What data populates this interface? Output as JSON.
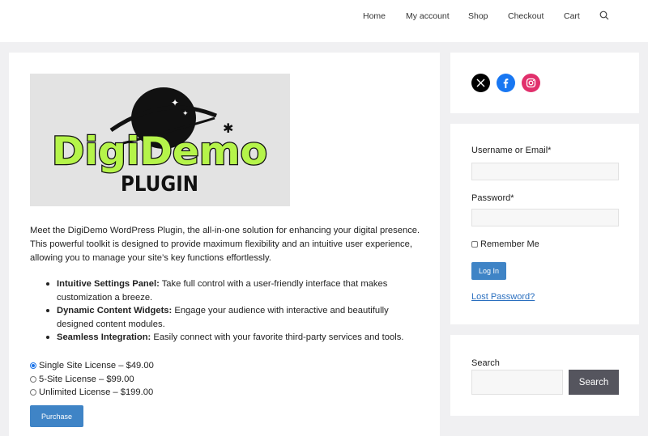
{
  "nav": {
    "items": [
      "Home",
      "My account",
      "Shop",
      "Checkout",
      "Cart"
    ],
    "search_icon": "search-icon"
  },
  "product": {
    "logo": {
      "line1": "DigiDemo",
      "line2": "PLUGIN"
    },
    "intro": "Meet the DigiDemo WordPress Plugin, the all-in-one solution for enhancing your digital presence. This powerful toolkit is designed to provide maximum flexibility and an intuitive user experience, allowing you to manage your site’s key functions effortlessly.",
    "features": [
      {
        "title": "Intuitive Settings Panel:",
        "text": "Take full control with a user-friendly interface that makes customization a breeze."
      },
      {
        "title": "Dynamic Content Widgets:",
        "text": "Engage your audience with interactive and beautifully designed content modules."
      },
      {
        "title": "Seamless Integration:",
        "text": "Easily connect with your favorite third-party services and tools."
      }
    ],
    "licenses": [
      {
        "label": "Single Site License – $49.00",
        "selected": true
      },
      {
        "label": "5-Site License – $99.00",
        "selected": false
      },
      {
        "label": "Unlimited License – $199.00",
        "selected": false
      }
    ],
    "purchase_label": "Purchase"
  },
  "social": [
    {
      "icon": "x-icon",
      "color": "#000000"
    },
    {
      "icon": "facebook-icon",
      "color": "#1877f2"
    },
    {
      "icon": "instagram-icon",
      "color": "#e1306c"
    }
  ],
  "login": {
    "username_label": "Username or Email*",
    "password_label": "Password*",
    "remember_label": "Remember Me",
    "login_label": "Log In",
    "lost_label": "Lost Password?"
  },
  "search": {
    "label": "Search",
    "button": "Search"
  },
  "colors": {
    "accent": "#3f84c6",
    "logo_green": "#b5f44a",
    "search_button": "#55555e"
  }
}
